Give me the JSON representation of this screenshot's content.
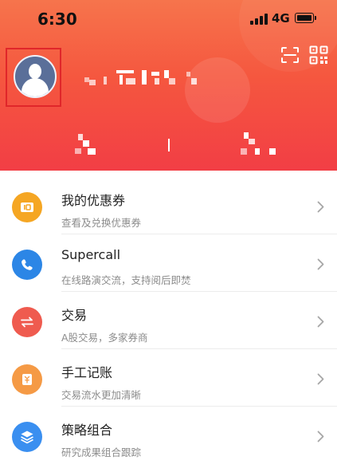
{
  "status_bar": {
    "time": "6:30",
    "network": "4G"
  },
  "header": {
    "icons": [
      "scan-icon",
      "qr-code-icon"
    ],
    "avatar_icon": "default-user-avatar"
  },
  "menu": {
    "items": [
      {
        "title": "我的优惠券",
        "subtitle": "查看及兑换优惠券",
        "icon": "coupon-icon",
        "color": "#f5a623"
      },
      {
        "title": "Supercall",
        "subtitle": "在线路演交流，支持阅后即焚",
        "icon": "phone-icon",
        "color": "#2c86e6"
      },
      {
        "title": "交易",
        "subtitle": "A股交易，多家券商",
        "icon": "exchange-icon",
        "color": "#ef5b4f"
      },
      {
        "title": "手工记账",
        "subtitle": "交易流水更加清晰",
        "icon": "ledger-icon",
        "color": "#f59a45"
      },
      {
        "title": "策略组合",
        "subtitle": "研究成果组合跟踪",
        "icon": "layers-icon",
        "color": "#3a8ff0"
      }
    ]
  },
  "colors": {
    "header_top": "#f6744c",
    "header_bottom": "#f23e45",
    "avatar_bg": "#5a6f99"
  }
}
